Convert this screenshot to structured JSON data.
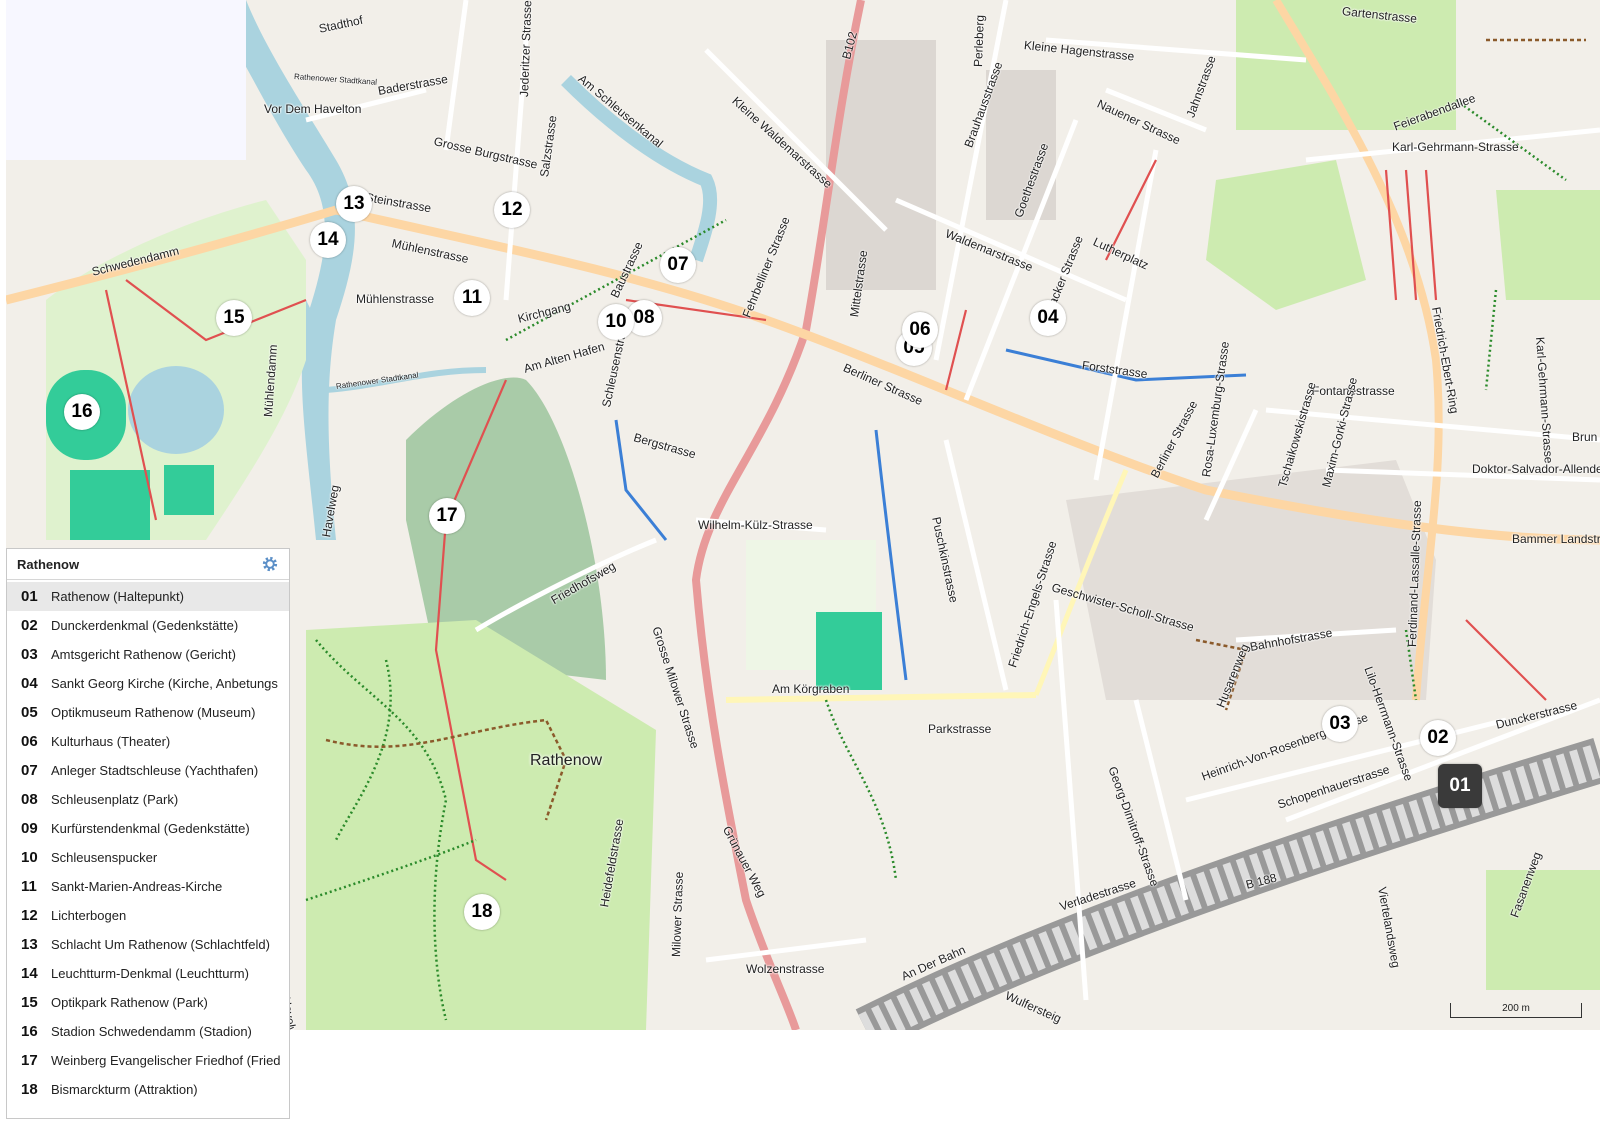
{
  "map": {
    "place_name": "Rathenow",
    "scale_label": "200 m",
    "colors": {
      "background": "#f2efe9",
      "park": "#cdebb0",
      "cemetery": "#a9cba8",
      "water": "#aad3df",
      "stadium": "#33cc99",
      "main_road": "#e89a9a",
      "secondary_road": "#fdd6a4",
      "path": "#e05050",
      "building": "#d9d0c9"
    },
    "streets": [
      "Stadthof",
      "Baderstrasse",
      "Vor Dem Havelton",
      "Grosse Burgstrasse",
      "Jederitzer Strasse",
      "Salzstrasse",
      "Am Schleusenkanal",
      "Steinstrasse",
      "Mühlenstrasse",
      "Mühlenstrasse",
      "Kirchgang",
      "Baustrasse",
      "Am Alten Hafen",
      "Schwedendamm",
      "Fehrbelliner Strasse",
      "Kleine Waldemarstrasse",
      "B102",
      "Mittelstrasse",
      "Berliner Strasse",
      "Waldemarstrasse",
      "Brauhausstrasse",
      "Goethestrasse",
      "Kleine Hagenstrasse",
      "Perleberg",
      "Nauener Strasse",
      "Jahnstrasse",
      "Lutherplatz",
      "Friesacker Strasse",
      "Forststrasse",
      "Fontanestrasse",
      "Gartenstrasse",
      "Feierabendallee",
      "Karl-Gehrmann-Strasse",
      "Friedrich-Ebert-Ring",
      "Karl-Gehrmann-Strasse",
      "Doktor-Salvador-Allende",
      "Bammer Landstr",
      "Brun",
      "Bergstrasse",
      "Schleusenstrasse",
      "Wilhelm-Külz-Strasse",
      "Friedhofsweg",
      "Grosse Milower Strasse",
      "Am Körgraben",
      "Parkstrasse",
      "Puschkinstrasse",
      "Geschwister-Scholl-Strasse",
      "Friedrich-Engels-Strasse",
      "Georg-Dimitroff-Strasse",
      "Berliner Strasse",
      "Rosa-Luxemburg-Strasse",
      "Tschaikowskistrasse",
      "Maxim-Gorki-Strasse",
      "Lilo-Herrmann-Strasse",
      "Ferdinand-Lassalle-Strasse",
      "Bahnhofstrasse",
      "Husarenweg",
      "Heinrich-Von-Rosenberg-Strasse",
      "Schopenhauerstrasse",
      "Dunckerstrasse",
      "Verladestrasse",
      "B 188",
      "An Der Bahn",
      "Wulfersteig",
      "Viertelandsweg",
      "Fasanenweg",
      "Heidefeldstrasse",
      "Milower Strasse",
      "Grünauer Weg",
      "Wolzenstrasse",
      "Havelweg",
      "Havelweg",
      "Rathenower Stadtkanal",
      "Rathenower Stadtkanal",
      "Mühlendamm",
      "Puschkinstrasse",
      "Grosse Burgstrasse"
    ],
    "markers": [
      "01",
      "02",
      "03",
      "04",
      "05",
      "06",
      "07",
      "08",
      "10",
      "11",
      "12",
      "13",
      "14",
      "15",
      "16",
      "17",
      "18"
    ]
  },
  "panel": {
    "title": "Rathenow",
    "items": [
      {
        "num": "01",
        "name": "Rathenow (Haltepunkt)"
      },
      {
        "num": "02",
        "name": "Dunckerdenkmal (Gedenkstätte)"
      },
      {
        "num": "03",
        "name": "Amtsgericht Rathenow (Gericht)"
      },
      {
        "num": "04",
        "name": "Sankt Georg Kirche (Kirche, Anbetungs"
      },
      {
        "num": "05",
        "name": "Optikmuseum Rathenow (Museum)"
      },
      {
        "num": "06",
        "name": "Kulturhaus (Theater)"
      },
      {
        "num": "07",
        "name": "Anleger Stadtschleuse (Yachthafen)"
      },
      {
        "num": "08",
        "name": "Schleusenplatz (Park)"
      },
      {
        "num": "09",
        "name": "Kurfürstendenkmal (Gedenkstätte)"
      },
      {
        "num": "10",
        "name": "Schleusenspucker"
      },
      {
        "num": "11",
        "name": "Sankt-Marien-Andreas-Kirche"
      },
      {
        "num": "12",
        "name": "Lichterbogen"
      },
      {
        "num": "13",
        "name": "Schlacht Um Rathenow (Schlachtfeld)"
      },
      {
        "num": "14",
        "name": "Leuchtturm-Denkmal (Leuchtturm)"
      },
      {
        "num": "15",
        "name": "Optikpark Rathenow (Park)"
      },
      {
        "num": "16",
        "name": "Stadion Schwedendamm (Stadion)"
      },
      {
        "num": "17",
        "name": "Weinberg Evangelischer Friedhof (Fried"
      },
      {
        "num": "18",
        "name": "Bismarckturm (Attraktion)"
      }
    ]
  }
}
